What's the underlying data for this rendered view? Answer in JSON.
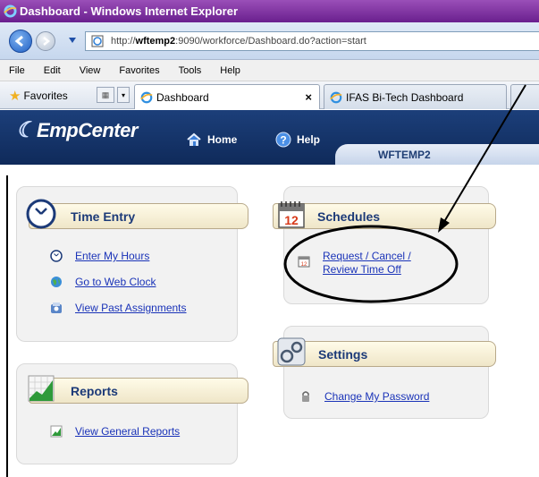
{
  "window": {
    "title": "Dashboard - Windows Internet Explorer"
  },
  "address": {
    "url_prefix": "http://",
    "url_host": "wftemp2",
    "url_rest": ":9090/workforce/Dashboard.do?action=start"
  },
  "menu": [
    "File",
    "Edit",
    "View",
    "Favorites",
    "Tools",
    "Help"
  ],
  "favorites": {
    "label": "Favorites"
  },
  "tabs": [
    {
      "label": "Dashboard",
      "close": "×"
    },
    {
      "label": "IFAS Bi-Tech Dashboard"
    }
  ],
  "app": {
    "logo": "EmpCenter",
    "home": "Home",
    "help": "Help",
    "host": "WFTEMP2"
  },
  "panels": {
    "time_entry": {
      "title": "Time Entry",
      "items": [
        "Enter My Hours",
        "Go to Web Clock",
        "View Past Assignments"
      ]
    },
    "schedules": {
      "title": "Schedules",
      "item_line1": "Request / Cancel /",
      "item_line2": "Review Time Off"
    },
    "settings": {
      "title": "Settings",
      "items": [
        "Change My Password"
      ]
    },
    "reports": {
      "title": "Reports",
      "items": [
        "View General Reports"
      ]
    }
  },
  "colors": {
    "titlebar": "#7a2fa0",
    "header": "#1a3b72",
    "link": "#1a33b8",
    "panel_title": "#1c3a78"
  }
}
